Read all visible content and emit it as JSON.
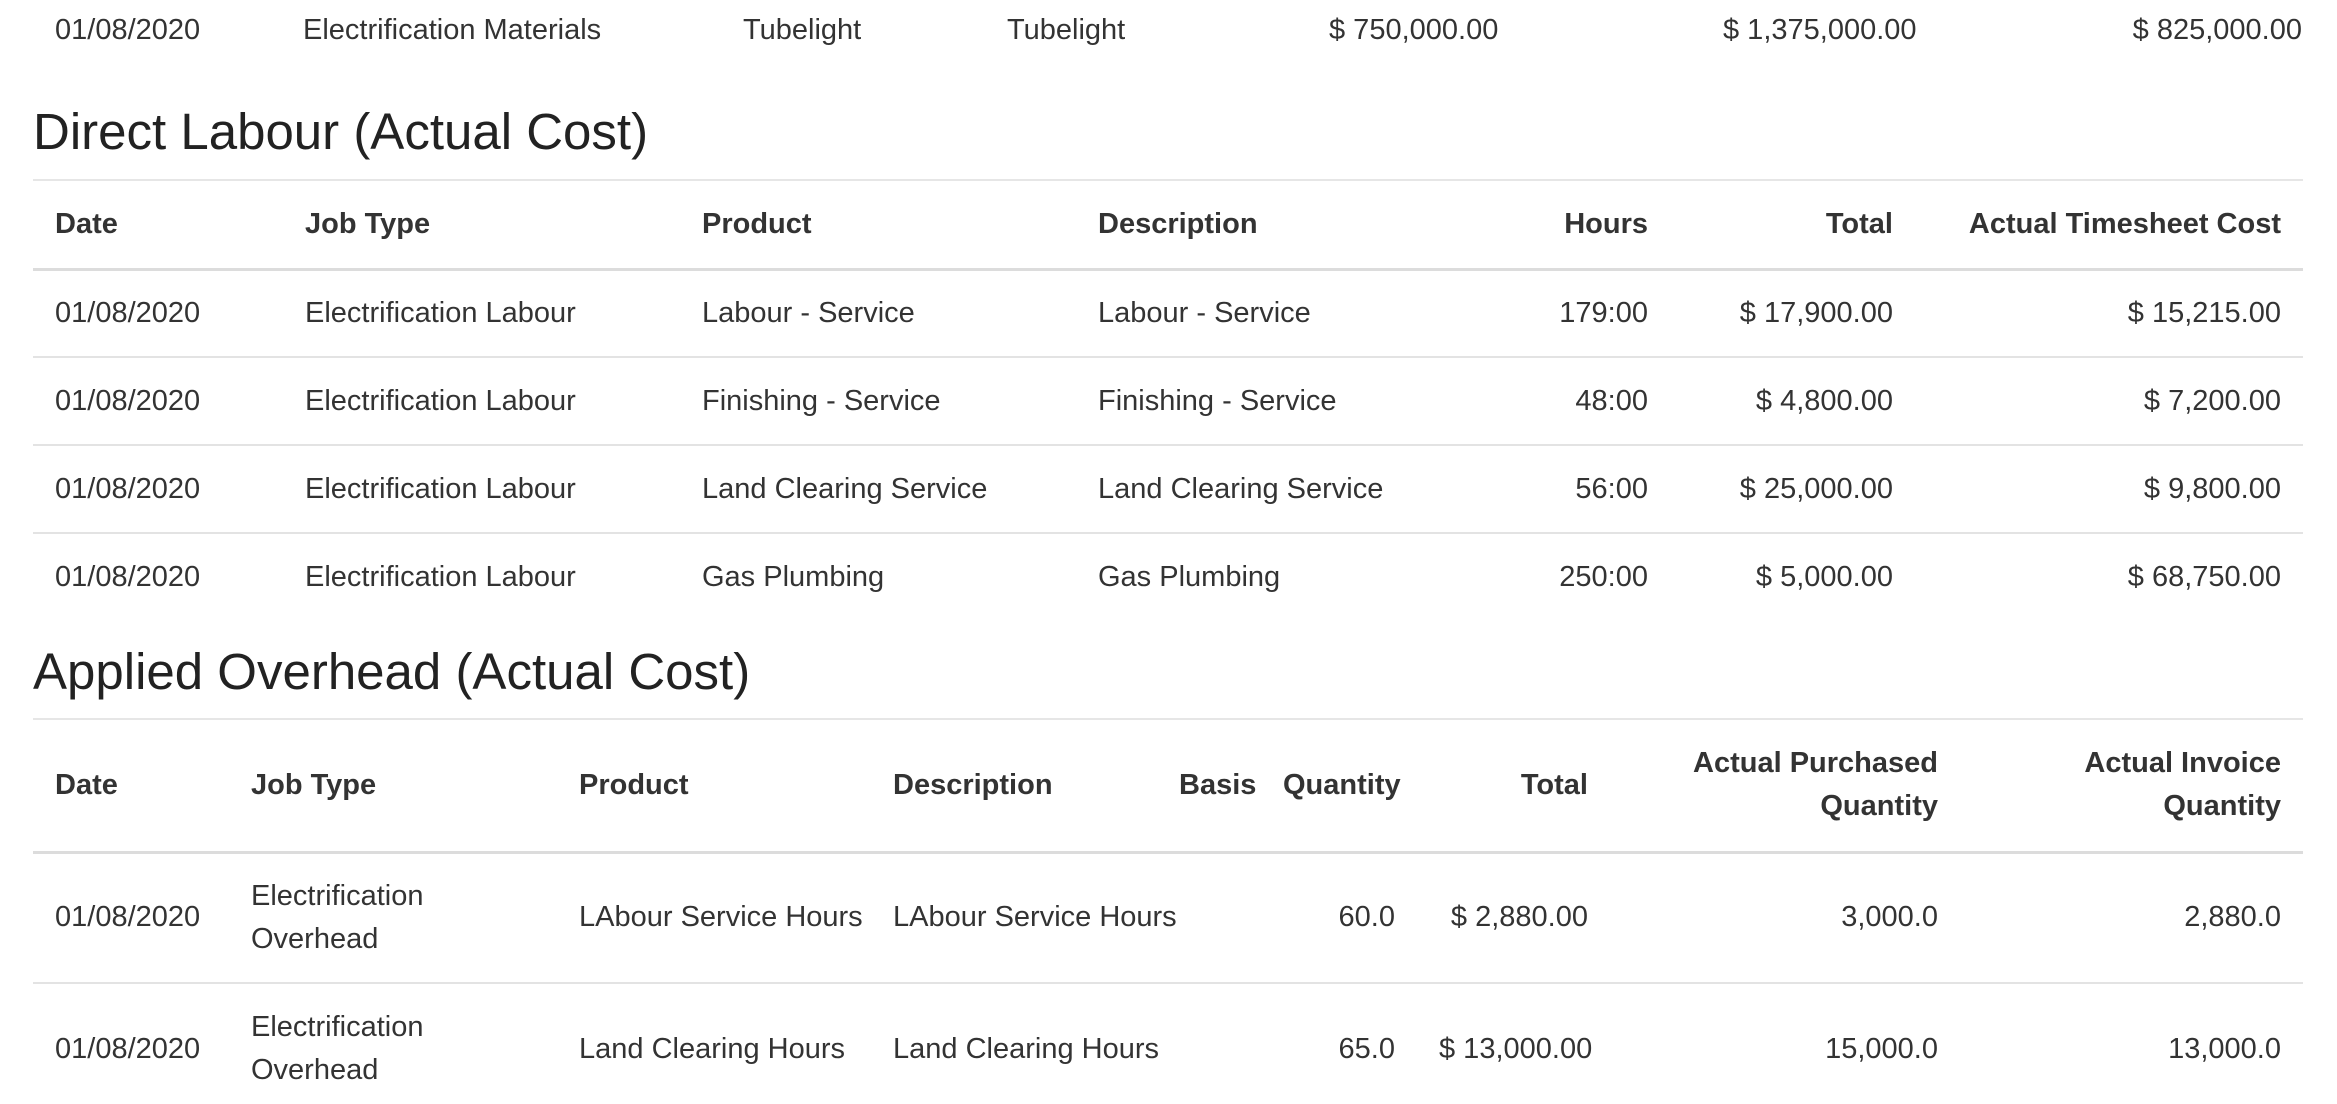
{
  "material_row": {
    "date": "01/08/2020",
    "job_type": "Electrification Materials",
    "product": "Tubelight",
    "description": "Tubelight",
    "value1": "$ 750,000.00",
    "value2": "$ 1,375,000.00",
    "value3": "$ 825,000.00"
  },
  "labour": {
    "title": "Direct Labour (Actual Cost)",
    "headers": {
      "date": "Date",
      "job_type": "Job Type",
      "product": "Product",
      "description": "Description",
      "hours": "Hours",
      "total": "Total",
      "actual_cost": "Actual Timesheet Cost"
    },
    "rows": [
      {
        "date": "01/08/2020",
        "job_type": "Electrification Labour",
        "product": "Labour - Service",
        "description": "Labour - Service",
        "hours": "179:00",
        "total": "$ 17,900.00",
        "actual_cost": "$ 15,215.00"
      },
      {
        "date": "01/08/2020",
        "job_type": "Electrification Labour",
        "product": "Finishing - Service",
        "description": "Finishing - Service",
        "hours": "48:00",
        "total": "$ 4,800.00",
        "actual_cost": "$ 7,200.00"
      },
      {
        "date": "01/08/2020",
        "job_type": "Electrification Labour",
        "product": "Land Clearing Service",
        "description": "Land Clearing Service",
        "hours": "56:00",
        "total": "$ 25,000.00",
        "actual_cost": "$ 9,800.00"
      },
      {
        "date": "01/08/2020",
        "job_type": "Electrification Labour",
        "product": "Gas Plumbing",
        "description": "Gas Plumbing",
        "hours": "250:00",
        "total": "$ 5,000.00",
        "actual_cost": "$ 68,750.00"
      }
    ]
  },
  "overhead": {
    "title": "Applied Overhead (Actual Cost)",
    "headers": {
      "date": "Date",
      "job_type": "Job Type",
      "product": "Product",
      "description": "Description",
      "basis": "Basis",
      "quantity": "Quantity",
      "total": "Total",
      "actual_purchased_qty": "Actual Purchased Quantity",
      "actual_invoice_qty": "Actual Invoice Quantity"
    },
    "rows": [
      {
        "date": "01/08/2020",
        "job_type": "Electrification Overhead",
        "product": "LAbour Service Hours",
        "description": "LAbour Service Hours",
        "basis": "",
        "quantity": "60.0",
        "total": "$ 2,880.00",
        "actual_purchased_qty": "3,000.0",
        "actual_invoice_qty": "2,880.0"
      },
      {
        "date": "01/08/2020",
        "job_type": "Electrification Overhead",
        "product": "Land Clearing Hours",
        "description": "Land Clearing Hours",
        "basis": "",
        "quantity": "65.0",
        "total": "$ 13,000.00",
        "actual_purchased_qty": "15,000.0",
        "actual_invoice_qty": "13,000.0"
      }
    ]
  }
}
